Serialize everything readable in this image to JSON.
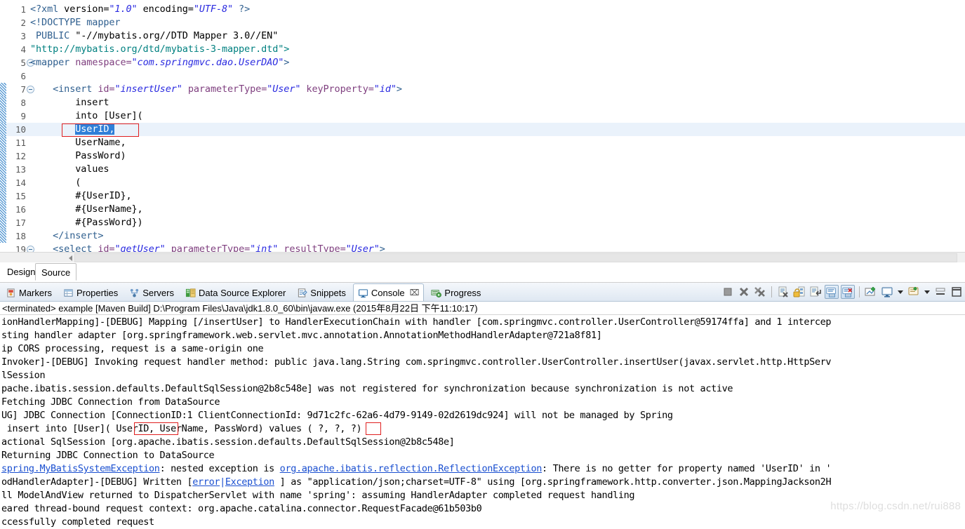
{
  "editor": {
    "lines": [
      {
        "num": "1",
        "fold": false,
        "foldbar": false,
        "current": false,
        "segments": [
          {
            "t": "<?xml ",
            "c": "tg"
          },
          {
            "t": "version=",
            "c": ""
          },
          {
            "t": "\"1.0\"",
            "c": "st"
          },
          {
            "t": " encoding=",
            "c": ""
          },
          {
            "t": "\"UTF-8\"",
            "c": "st"
          },
          {
            "t": " ?>",
            "c": "tg"
          }
        ]
      },
      {
        "num": "2",
        "fold": false,
        "foldbar": false,
        "current": false,
        "segments": [
          {
            "t": "<!DOCTYPE mapper",
            "c": "tg"
          }
        ]
      },
      {
        "num": "3",
        "fold": false,
        "foldbar": false,
        "current": false,
        "segments": [
          {
            "t": " PUBLIC ",
            "c": "tg"
          },
          {
            "t": "\"-//mybatis.org//DTD Mapper 3.0//EN\"",
            "c": ""
          }
        ]
      },
      {
        "num": "4",
        "fold": false,
        "foldbar": false,
        "current": false,
        "segments": [
          {
            "t": "\"http://mybatis.org/dtd/mybatis-3-mapper.dtd\">",
            "c": "sp"
          }
        ]
      },
      {
        "num": "5",
        "fold": true,
        "foldbar": false,
        "current": false,
        "segments": [
          {
            "t": "<mapper ",
            "c": "tg"
          },
          {
            "t": "namespace=",
            "c": "at"
          },
          {
            "t": "\"com.springmvc.dao.UserDAO\"",
            "c": "st"
          },
          {
            "t": ">",
            "c": "tg"
          }
        ]
      },
      {
        "num": "6",
        "fold": false,
        "foldbar": false,
        "current": false,
        "segments": []
      },
      {
        "num": "7",
        "fold": true,
        "foldbar": true,
        "current": false,
        "segments": [
          {
            "t": "    ",
            "c": ""
          },
          {
            "t": "<insert ",
            "c": "tg"
          },
          {
            "t": "id=",
            "c": "at"
          },
          {
            "t": "\"insertUser\"",
            "c": "st"
          },
          {
            "t": " ",
            "c": ""
          },
          {
            "t": "parameterType=",
            "c": "at"
          },
          {
            "t": "\"User\"",
            "c": "st"
          },
          {
            "t": " ",
            "c": ""
          },
          {
            "t": "keyProperty=",
            "c": "at"
          },
          {
            "t": "\"id\"",
            "c": "st"
          },
          {
            "t": ">",
            "c": "tg"
          }
        ]
      },
      {
        "num": "8",
        "fold": false,
        "foldbar": true,
        "current": false,
        "segments": [
          {
            "t": "        insert",
            "c": ""
          }
        ]
      },
      {
        "num": "9",
        "fold": false,
        "foldbar": true,
        "current": false,
        "segments": [
          {
            "t": "        into [User](",
            "c": ""
          }
        ]
      },
      {
        "num": "10",
        "fold": false,
        "foldbar": true,
        "current": true,
        "segments": [
          {
            "t": "        ",
            "c": ""
          },
          {
            "t": "UserID,",
            "c": "sel"
          }
        ]
      },
      {
        "num": "11",
        "fold": false,
        "foldbar": true,
        "current": false,
        "segments": [
          {
            "t": "        UserName,",
            "c": ""
          }
        ]
      },
      {
        "num": "12",
        "fold": false,
        "foldbar": true,
        "current": false,
        "segments": [
          {
            "t": "        PassWord)",
            "c": ""
          }
        ]
      },
      {
        "num": "13",
        "fold": false,
        "foldbar": true,
        "current": false,
        "segments": [
          {
            "t": "        values",
            "c": ""
          }
        ]
      },
      {
        "num": "14",
        "fold": false,
        "foldbar": true,
        "current": false,
        "segments": [
          {
            "t": "        (",
            "c": ""
          }
        ]
      },
      {
        "num": "15",
        "fold": false,
        "foldbar": true,
        "current": false,
        "segments": [
          {
            "t": "        #{UserID},",
            "c": ""
          }
        ]
      },
      {
        "num": "16",
        "fold": false,
        "foldbar": true,
        "current": false,
        "segments": [
          {
            "t": "        #{UserName},",
            "c": ""
          }
        ]
      },
      {
        "num": "17",
        "fold": false,
        "foldbar": true,
        "current": false,
        "segments": [
          {
            "t": "        #{PassWord})",
            "c": ""
          }
        ]
      },
      {
        "num": "18",
        "fold": false,
        "foldbar": true,
        "current": false,
        "segments": [
          {
            "t": "    ",
            "c": ""
          },
          {
            "t": "</insert>",
            "c": "tg"
          }
        ]
      },
      {
        "num": "19",
        "fold": true,
        "foldbar": false,
        "current": false,
        "segments": [
          {
            "t": "    ",
            "c": ""
          },
          {
            "t": "<select ",
            "c": "tg"
          },
          {
            "t": "id=",
            "c": "at"
          },
          {
            "t": "\"getUser\"",
            "c": "st"
          },
          {
            "t": " ",
            "c": ""
          },
          {
            "t": "parameterType=",
            "c": "at"
          },
          {
            "t": "\"int\"",
            "c": "st"
          },
          {
            "t": " ",
            "c": ""
          },
          {
            "t": "resultType=",
            "c": "at"
          },
          {
            "t": "\"User\"",
            "c": "st"
          },
          {
            "t": ">",
            "c": "tg"
          }
        ]
      }
    ],
    "annotation_box_label": "UserID-highlight-box"
  },
  "design_tabs": {
    "design_label": "Design",
    "source_label": "Source",
    "selected": "Source"
  },
  "view_tabs": [
    {
      "label": "Markers",
      "icon": "markers-icon",
      "active": false,
      "closable": false
    },
    {
      "label": "Properties",
      "icon": "properties-icon",
      "active": false,
      "closable": false
    },
    {
      "label": "Servers",
      "icon": "servers-icon",
      "active": false,
      "closable": false
    },
    {
      "label": "Data Source Explorer",
      "icon": "datasource-icon",
      "active": false,
      "closable": false
    },
    {
      "label": "Snippets",
      "icon": "snippets-icon",
      "active": false,
      "closable": false
    },
    {
      "label": "Console",
      "icon": "console-icon",
      "active": true,
      "closable": true
    },
    {
      "label": "Progress",
      "icon": "progress-icon",
      "active": false,
      "closable": false
    }
  ],
  "toolbar": [
    {
      "name": "terminate-button",
      "pressed": false
    },
    {
      "name": "remove-launch-button",
      "pressed": false
    },
    {
      "name": "remove-all-terminated-button",
      "pressed": false
    },
    {
      "name": "separator-1",
      "pressed": false
    },
    {
      "name": "clear-console-button",
      "pressed": false
    },
    {
      "name": "scroll-lock-button",
      "pressed": false
    },
    {
      "name": "word-wrap-button",
      "pressed": false
    },
    {
      "name": "show-console-on-output-button",
      "pressed": true
    },
    {
      "name": "show-console-on-error-button",
      "pressed": true
    },
    {
      "name": "separator-2",
      "pressed": false
    },
    {
      "name": "pin-console-button",
      "pressed": false
    },
    {
      "name": "display-selected-console-button",
      "pressed": false
    },
    {
      "name": "console-dropdown-arrow",
      "pressed": false
    },
    {
      "name": "open-console-button",
      "pressed": false
    },
    {
      "name": "open-console-dropdown-arrow",
      "pressed": false
    },
    {
      "name": "minimize-button",
      "pressed": false
    },
    {
      "name": "maximize-button",
      "pressed": false
    }
  ],
  "terminated_line": "<terminated> example [Maven Build] D:\\Program Files\\Java\\jdk1.8.0_60\\bin\\javaw.exe (2015年8月22日 下午11:10:17)",
  "console_lines": [
    {
      "segments": [
        {
          "t": "ionHandlerMapping]-[DEBUG] Mapping [/insertUser] to HandlerExecutionChain with handler [com.springmvc.controller.UserController@59174ffa] and 1 intercep",
          "c": ""
        }
      ]
    },
    {
      "segments": [
        {
          "t": "sting handler adapter [org.springframework.web.servlet.mvc.annotation.AnnotationMethodHandlerAdapter@721a8f81]",
          "c": ""
        }
      ]
    },
    {
      "segments": [
        {
          "t": "ip CORS processing, request is a same-origin one",
          "c": ""
        }
      ]
    },
    {
      "segments": [
        {
          "t": "Invoker]-[DEBUG] Invoking request handler method: public java.lang.String com.springmvc.controller.UserController.insertUser(javax.servlet.http.HttpServ",
          "c": ""
        }
      ]
    },
    {
      "segments": [
        {
          "t": "lSession",
          "c": ""
        }
      ]
    },
    {
      "segments": [
        {
          "t": "pache.ibatis.session.defaults.DefaultSqlSession@2b8c548e] was not registered for synchronization because synchronization is not active",
          "c": ""
        }
      ]
    },
    {
      "segments": [
        {
          "t": "Fetching JDBC Connection from DataSource",
          "c": ""
        }
      ]
    },
    {
      "segments": [
        {
          "t": "UG] JDBC Connection [ConnectionID:1 ClientConnectionId: 9d71c2fc-62a6-4d79-9149-02d2619dc924] will not be managed by Spring",
          "c": ""
        }
      ]
    },
    {
      "segments": [
        {
          "t": " insert into [User]( UserID, UserName, PassWord) values ( ?, ?, ?)",
          "c": ""
        }
      ]
    },
    {
      "segments": [
        {
          "t": "actional SqlSession [org.apache.ibatis.session.defaults.DefaultSqlSession@2b8c548e]",
          "c": ""
        }
      ]
    },
    {
      "segments": [
        {
          "t": "Returning JDBC Connection to DataSource",
          "c": ""
        }
      ]
    },
    {
      "segments": [
        {
          "t": "spring.MyBatisSystemException",
          "c": "lnk"
        },
        {
          "t": ": nested exception is ",
          "c": ""
        },
        {
          "t": "org.apache.ibatis.reflection.ReflectionException",
          "c": "lnk"
        },
        {
          "t": ": There is no getter for property named 'UserID' in '",
          "c": ""
        }
      ]
    },
    {
      "segments": [
        {
          "t": "odHandlerAdapter]-[DEBUG] Written [",
          "c": ""
        },
        {
          "t": "error",
          "c": "lnk"
        },
        {
          "t": "|",
          "c": "sepbar"
        },
        {
          "t": "Exception",
          "c": "lnk"
        },
        {
          "t": " ] as \"application/json;charset=UTF-8\" using [org.springframework.http.converter.json.MappingJackson2H",
          "c": ""
        }
      ]
    },
    {
      "segments": [
        {
          "t": "ll ModelAndView returned to DispatcherServlet with name 'spring': assuming HandlerAdapter completed request handling",
          "c": ""
        }
      ]
    },
    {
      "segments": [
        {
          "t": "eared thread-bound request context: org.apache.catalina.connector.RequestFacade@61b503b0",
          "c": ""
        }
      ]
    },
    {
      "segments": [
        {
          "t": "ccessfully completed request",
          "c": ""
        }
      ]
    }
  ],
  "annotations": {
    "console_userid_box": "UserID-console-highlight-box",
    "console_param_box": "question-mark-param-highlight-box"
  },
  "watermark": "https://blog.csdn.net/rui888",
  "colors": {
    "selection_blue": "#2f7fd8",
    "current_line": "#eaf2fb",
    "annotation_red": "#e02020",
    "link_blue": "#1a4fd0",
    "string_blue": "#2a2ae0",
    "tag_blue": "#2f5f8f",
    "attribute_purple": "#7f3f7f"
  }
}
